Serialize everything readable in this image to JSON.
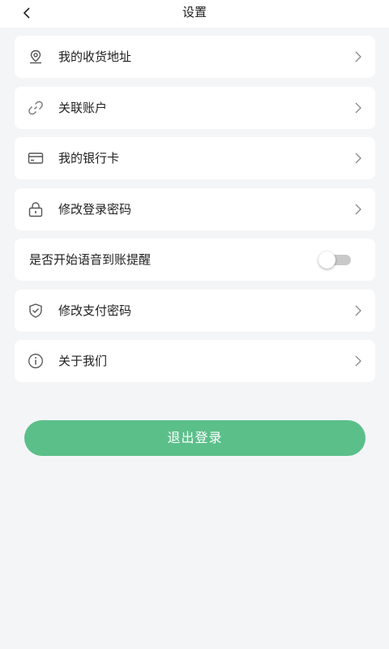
{
  "header": {
    "title": "设置",
    "back_icon": "chevron-left-icon"
  },
  "settings": {
    "items": [
      {
        "label": "我的收货地址",
        "icon": "location-pin-icon"
      },
      {
        "label": "关联账户",
        "icon": "link-icon"
      },
      {
        "label": "我的银行卡",
        "icon": "bank-card-icon"
      },
      {
        "label": "修改登录密码",
        "icon": "lock-icon"
      },
      {
        "label": "是否开始语音到账提醒",
        "toggle": "off"
      },
      {
        "label": "修改支付密码",
        "icon": "shield-check-icon"
      },
      {
        "label": "关于我们",
        "icon": "info-circle-icon"
      }
    ]
  },
  "logout_label": "退出登录",
  "colors": {
    "accent": "#5bbf8a",
    "background": "#f4f5f7"
  }
}
